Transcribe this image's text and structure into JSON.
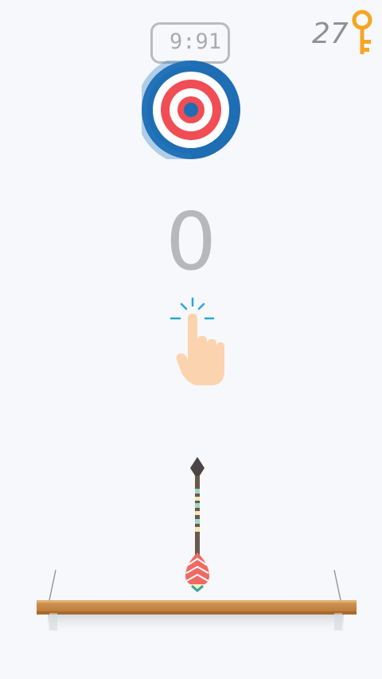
{
  "hud": {
    "timer": "9:91",
    "keys_count": "27"
  },
  "score": "0",
  "colors": {
    "background": "#f7f8fb",
    "target_blue": "#1f6db3",
    "target_red": "#f04e54",
    "key_gold": "#f5a623",
    "hand_skin": "#fbd3ae",
    "tap_lines": "#29a8d6",
    "shelf_wood": "#c98c45"
  },
  "icons": {
    "key": "key-icon",
    "target": "bullseye-target-icon",
    "tap_hint": "tap-hand-icon",
    "arrow": "arrow-icon",
    "shelf": "wooden-shelf"
  }
}
